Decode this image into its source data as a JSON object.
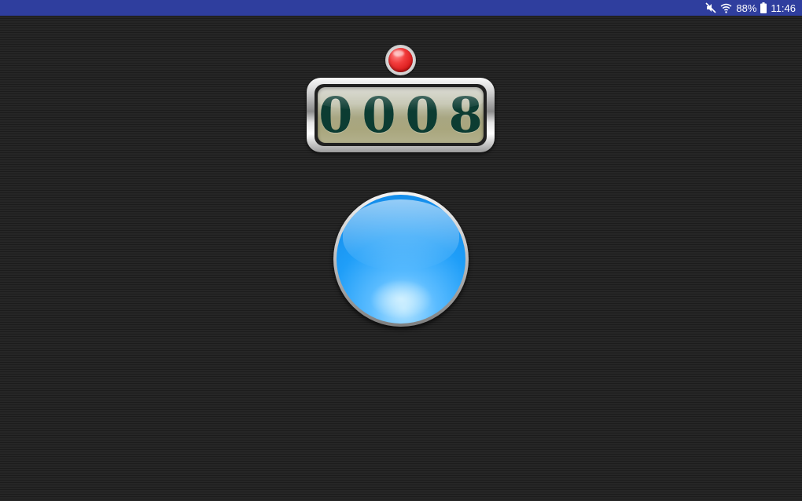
{
  "status_bar": {
    "battery_percent": "88%",
    "time": "11:46",
    "icons": [
      "mute-icon",
      "wifi-icon",
      "battery-icon"
    ],
    "background_color": "#2f3e9e"
  },
  "reset_led": {
    "icon": "red-led-icon",
    "color": "#e52a2a"
  },
  "counter": {
    "value": "0008",
    "digit_color": "#0c3c32"
  },
  "count_button": {
    "icon": "blue-round-button-icon",
    "color": "#1f9ef8"
  }
}
